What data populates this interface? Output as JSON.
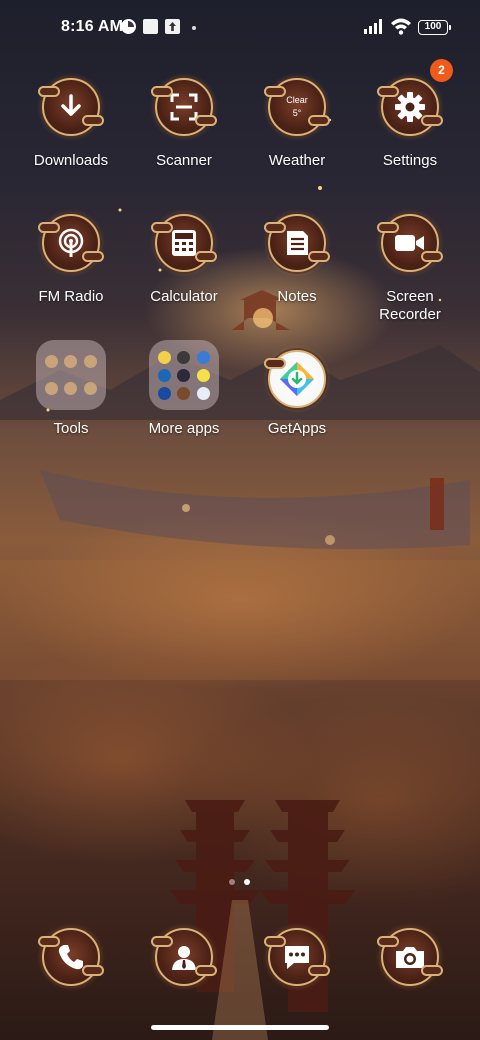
{
  "status_bar": {
    "time": "8:16 AM",
    "battery": "100",
    "icons": [
      "data-saver-icon",
      "notification-square-icon",
      "upload-icon",
      "dot-icon",
      "signal-icon",
      "wifi-icon",
      "battery-icon"
    ]
  },
  "apps": {
    "row1": [
      {
        "label": "Downloads",
        "icon": "download-icon"
      },
      {
        "label": "Scanner",
        "icon": "scanner-icon"
      },
      {
        "label": "Weather",
        "icon": "weather-icon",
        "condition": "Clear",
        "temp": "5°"
      },
      {
        "label": "Settings",
        "icon": "gear-icon",
        "badge": "2"
      }
    ],
    "row2": [
      {
        "label": "FM Radio",
        "icon": "radio-icon"
      },
      {
        "label": "Calculator",
        "icon": "calculator-icon"
      },
      {
        "label": "Notes",
        "icon": "notes-icon"
      },
      {
        "label": "Screen Recorder",
        "icon": "video-camera-icon"
      }
    ],
    "row3": [
      {
        "label": "Tools",
        "icon": "folder-icon"
      },
      {
        "label": "More apps",
        "icon": "folder-icon"
      },
      {
        "label": "GetApps",
        "icon": "getapps-icon"
      }
    ]
  },
  "dock": [
    {
      "name": "Phone",
      "icon": "phone-icon"
    },
    {
      "name": "Contacts",
      "icon": "contacts-icon"
    },
    {
      "name": "Messaging",
      "icon": "message-icon"
    },
    {
      "name": "Camera",
      "icon": "camera-icon"
    }
  ],
  "colors": {
    "badge": "#f05a1a",
    "icon_ring": "#d9b27a",
    "icon_fill": "#4c2216"
  },
  "page_indicator": {
    "count": 2,
    "active": 2
  }
}
